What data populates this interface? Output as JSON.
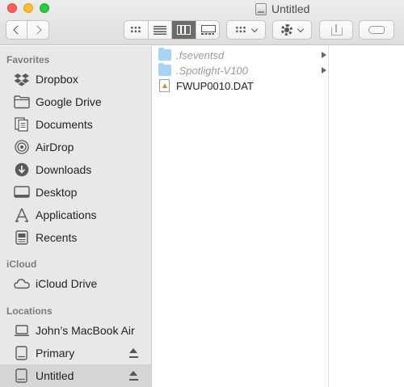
{
  "window": {
    "title": "Untitled"
  },
  "toolbar": {
    "back_icon": "chevron-left-icon",
    "forward_icon": "chevron-right-icon",
    "view_modes": [
      "icon-view",
      "list-view",
      "column-view",
      "gallery-view"
    ],
    "active_view": "column-view",
    "group_icon": "grid-icon",
    "action_icon": "gear-icon",
    "share_icon": "share-icon",
    "tag_icon": "tag-icon"
  },
  "sidebar": {
    "favorites_title": "Favorites",
    "favorites": [
      {
        "label": "Dropbox",
        "icon": "dropbox-icon"
      },
      {
        "label": "Google Drive",
        "icon": "folder-icon"
      },
      {
        "label": "Documents",
        "icon": "documents-icon"
      },
      {
        "label": "AirDrop",
        "icon": "airdrop-icon"
      },
      {
        "label": "Downloads",
        "icon": "downloads-icon"
      },
      {
        "label": "Desktop",
        "icon": "desktop-icon"
      },
      {
        "label": "Applications",
        "icon": "applications-icon"
      },
      {
        "label": "Recents",
        "icon": "recents-icon"
      }
    ],
    "icloud_title": "iCloud",
    "icloud": [
      {
        "label": "iCloud Drive",
        "icon": "cloud-icon"
      }
    ],
    "locations_title": "Locations",
    "locations": [
      {
        "label": "John’s MacBook Air",
        "icon": "laptop-icon"
      },
      {
        "label": "Primary",
        "icon": "disk-icon",
        "ejectable": true
      },
      {
        "label": "Untitled",
        "icon": "disk-icon",
        "ejectable": true,
        "selected": true
      }
    ]
  },
  "files": [
    {
      "name": ".fseventsd",
      "type": "folder",
      "hidden": true,
      "has_children": true
    },
    {
      "name": ".Spotlight-V100",
      "type": "folder",
      "hidden": true,
      "has_children": true
    },
    {
      "name": "FWUP0010.DAT",
      "type": "document",
      "hidden": false,
      "has_children": false
    }
  ],
  "colors": {
    "sidebar_bg": "#e8e8e8",
    "selected_bg": "#d5d5d5",
    "folder_blue": "#a8d3f4",
    "close": "#fe5f57",
    "minimize": "#febc2e",
    "maximize": "#28c840"
  }
}
